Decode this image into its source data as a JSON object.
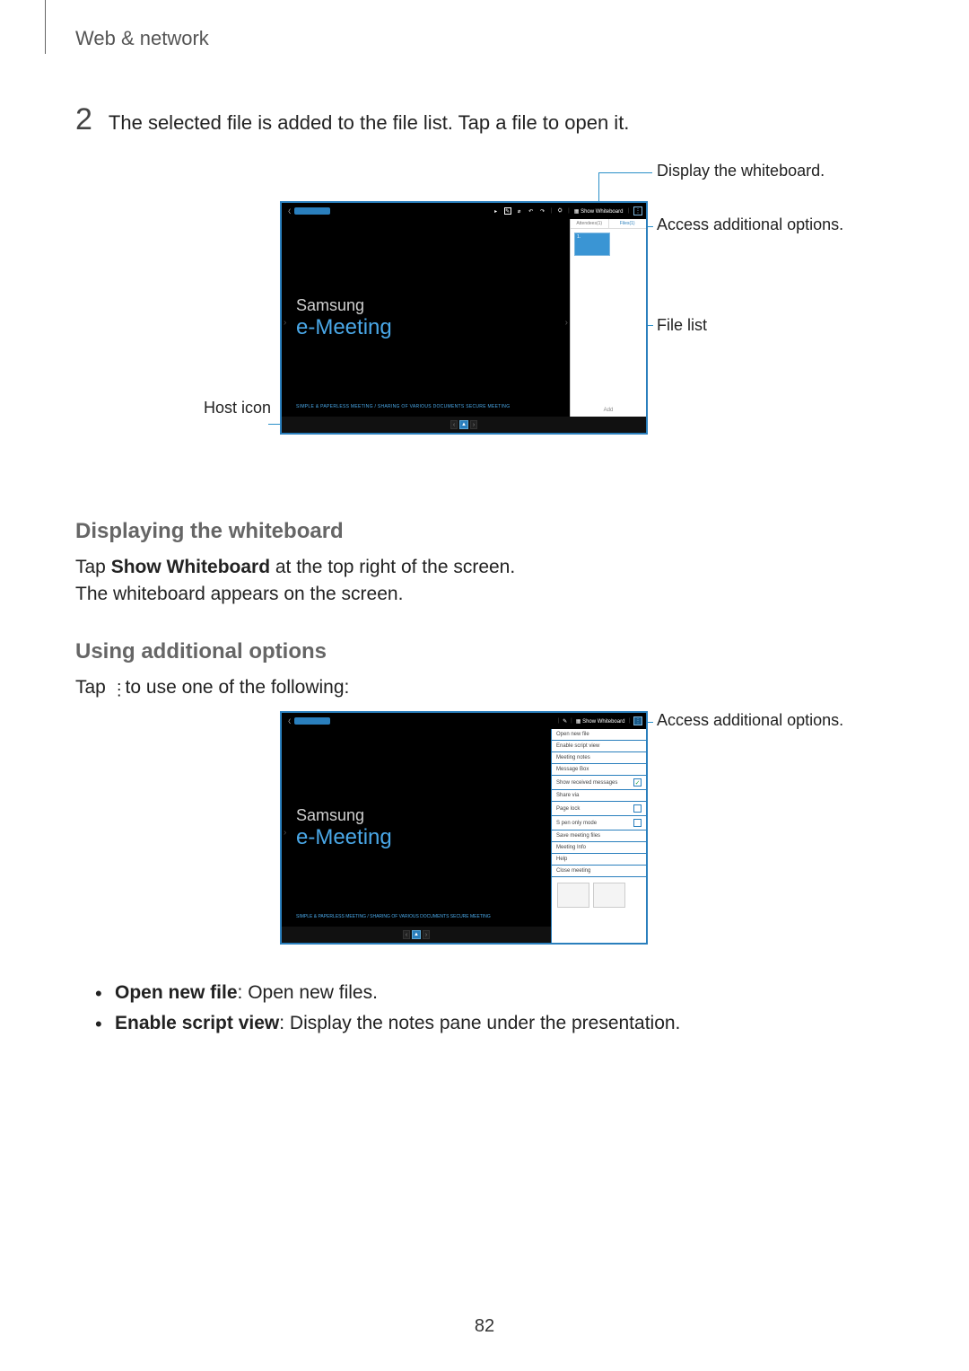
{
  "header": {
    "section": "Web & network"
  },
  "step": {
    "number": "2",
    "text": "The selected file is added to the file list. Tap a file to open it."
  },
  "fig1": {
    "toolbar": {
      "show_whiteboard": "Show Whiteboard"
    },
    "brand": "Samsung",
    "product": "e-Meeting",
    "tagline": "SIMPLE & PAPERLESS MEETING / SHARING OF VARIOUS DOCUMENTS\nSECURE MEETING",
    "side": {
      "tab_attendees": "Attendees(1)",
      "tab_files": "Files(1)",
      "add": "Add"
    },
    "callouts": {
      "whiteboard": "Display the whiteboard.",
      "options": "Access additional options.",
      "filelist": "File list",
      "hosticon": "Host icon"
    }
  },
  "sec1": {
    "heading": "Displaying the whiteboard",
    "p1_pre": "Tap ",
    "p1_bold": "Show Whiteboard",
    "p1_post": " at the top right of the screen.",
    "p2": "The whiteboard appears on the screen."
  },
  "sec2": {
    "heading": "Using additional options",
    "p1_pre": "Tap ",
    "p1_post": " to use one of the following:"
  },
  "fig2": {
    "toolbar": {
      "show_whiteboard": "Show Whiteboard"
    },
    "brand": "Samsung",
    "product": "e-Meeting",
    "tagline": "SIMPLE & PAPERLESS MEETING / SHARING OF VARIOUS DOCUMENTS\nSECURE MEETING",
    "menu": {
      "open_new_file": "Open new file",
      "enable_script_view": "Enable script view",
      "meeting_notes": "Meeting notes",
      "message_box": "Message Box",
      "show_received_messages": "Show received messages",
      "share_via": "Share via",
      "page_lock": "Page lock",
      "s_pen_only_mode": "S pen only mode",
      "save_meeting_files": "Save meeting files",
      "meeting_info": "Meeting Info",
      "help": "Help",
      "close_meeting": "Close meeting"
    },
    "callout": "Access additional options."
  },
  "bullets": {
    "b1_bold": "Open new file",
    "b1_rest": ": Open new files.",
    "b2_bold": "Enable script view",
    "b2_rest": ": Display the notes pane under the presentation."
  },
  "page": "82"
}
